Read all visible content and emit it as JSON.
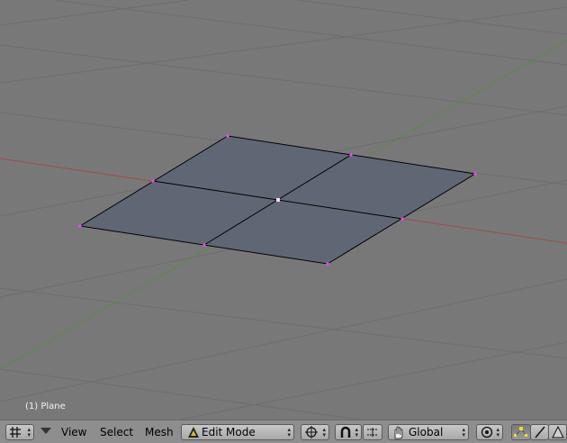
{
  "viewport": {
    "object_label": "(1) Plane",
    "colors": {
      "background": "#787878",
      "grid": "#6e6e6e",
      "x_axis": "#a04a4a",
      "y_axis": "#5a8a4a",
      "face": "#606774",
      "edge": "#000000",
      "vertex": "#ff40ff"
    }
  },
  "header": {
    "editor_type_icon": "grid-view-icon",
    "menus": {
      "view": "View",
      "select": "Select",
      "mesh": "Mesh"
    },
    "mode": {
      "label": "Edit Mode",
      "icon": "edit-mode-triangle-icon"
    },
    "orientation": {
      "label": "Global",
      "icon": "hand-icon"
    },
    "select_modes": [
      "vertex-select-icon",
      "edge-select-icon",
      "face-select-icon"
    ]
  }
}
